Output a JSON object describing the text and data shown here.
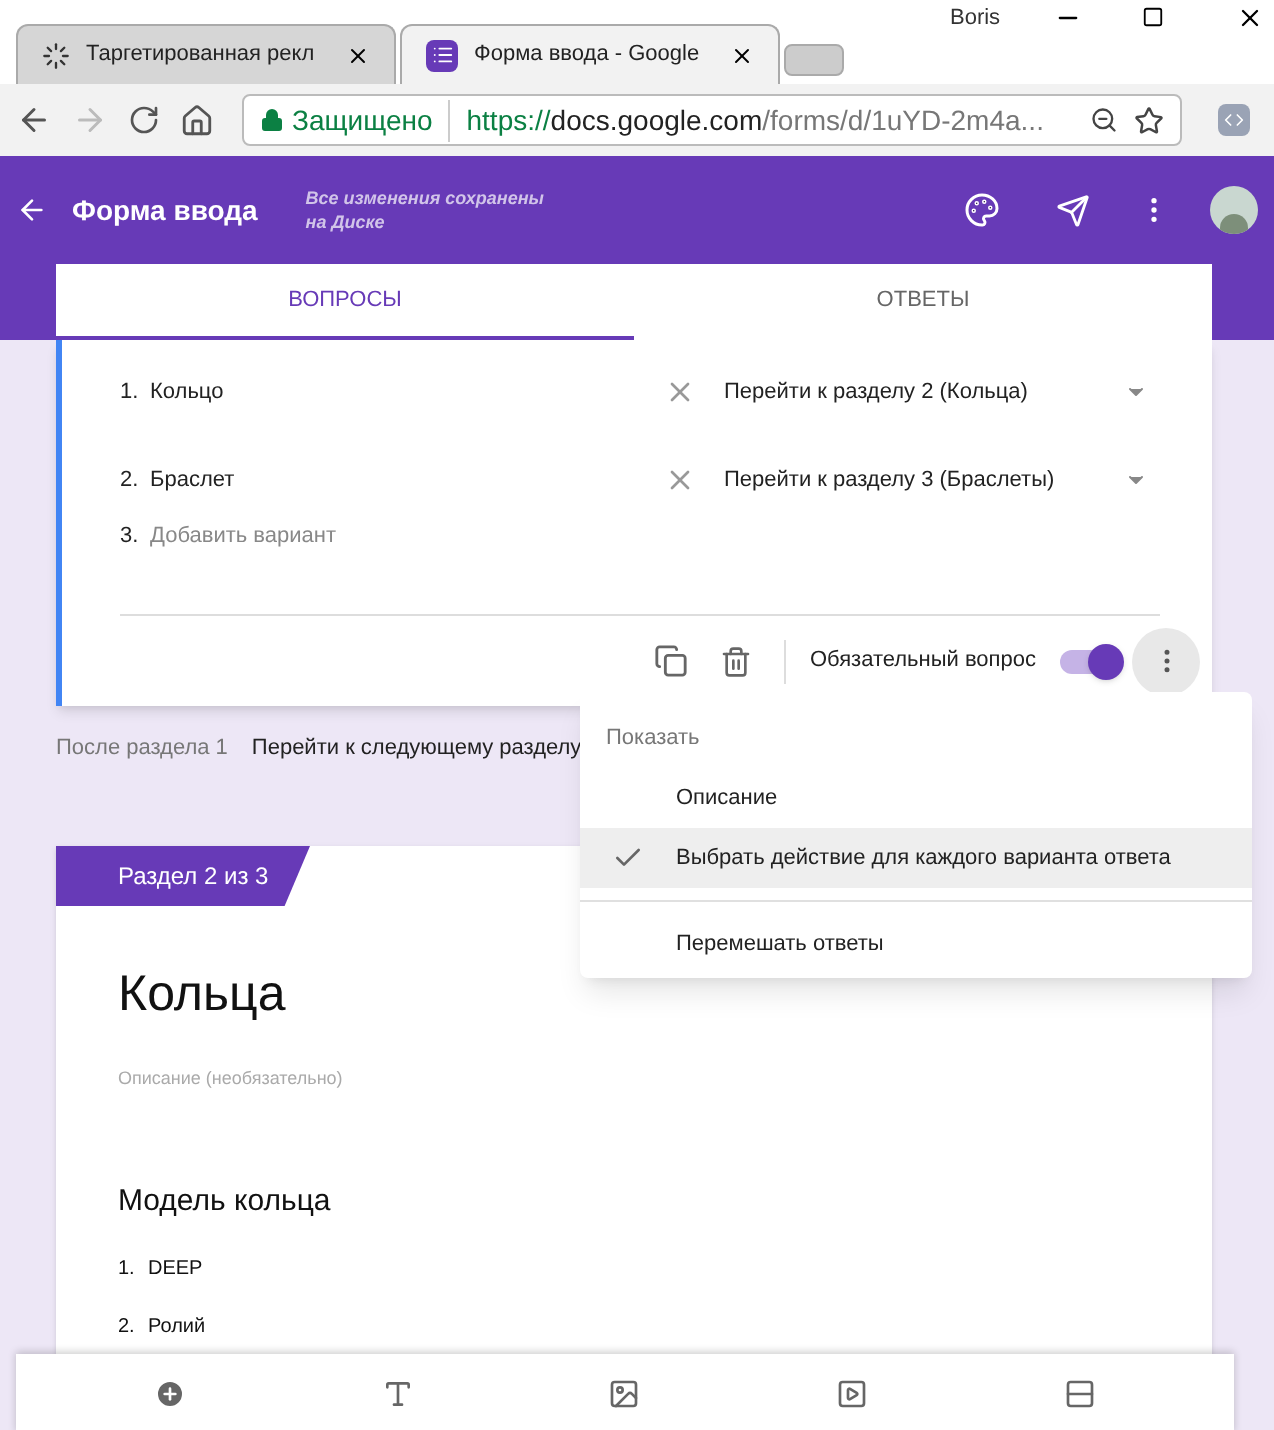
{
  "browser": {
    "profile": "Boris",
    "tabs": [
      {
        "title": "Таргетированная рекл",
        "selected": false,
        "kind": "loading"
      },
      {
        "title": "Форма ввода - Google",
        "selected": true,
        "kind": "forms"
      }
    ],
    "security_label": "Защищено",
    "url": {
      "scheme": "https://",
      "domain": "docs.google.com",
      "path": "/forms/d/1uYD-2m4a..."
    }
  },
  "app_bar": {
    "title": "Форма ввода",
    "save_status": "Все изменения сохранены на Диске"
  },
  "form_tabs": [
    {
      "label": "ВОПРОСЫ",
      "selected": true
    },
    {
      "label": "ОТВЕТЫ",
      "selected": false
    }
  ],
  "question": {
    "options": [
      {
        "number": "1.",
        "label": "Кольцо",
        "goto": "Перейти к разделу 2 (Кольца)"
      },
      {
        "number": "2.",
        "label": "Браслет",
        "goto": "Перейти к разделу 3 (Браслеты)"
      }
    ],
    "add_option": {
      "number": "3.",
      "placeholder": "Добавить вариант"
    },
    "required_label": "Обязательный вопрос",
    "required": true
  },
  "after_section": {
    "label": "После раздела 1",
    "action": "Перейти к следующему разделу"
  },
  "menu": {
    "header": "Показать",
    "items": [
      {
        "label": "Описание",
        "checked": false,
        "highlighted": false,
        "divider_before": false
      },
      {
        "label": "Выбрать действие для каждого варианта ответа",
        "checked": true,
        "highlighted": true,
        "divider_before": false
      },
      {
        "label": "Перемешать ответы",
        "checked": false,
        "highlighted": false,
        "divider_before": true
      }
    ]
  },
  "section": {
    "badge": "Раздел 2 из 3",
    "title": "Кольца",
    "description_placeholder": "Описание (необязательно)",
    "question_title": "Модель кольца",
    "options": [
      {
        "number": "1.",
        "label": "DEEP"
      },
      {
        "number": "2.",
        "label": "Ролий"
      }
    ]
  }
}
